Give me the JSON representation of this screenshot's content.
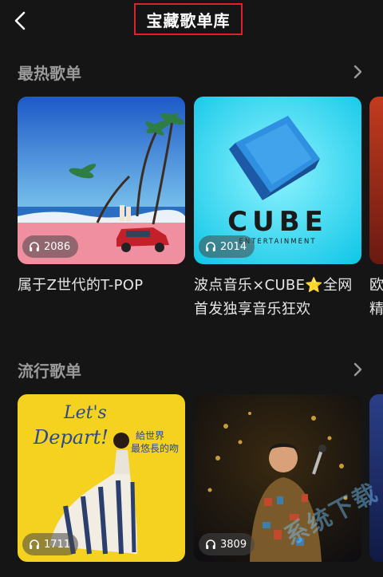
{
  "header": {
    "title": "宝藏歌单库"
  },
  "sections": [
    {
      "title": "最热歌单",
      "cards": [
        {
          "plays": "2086",
          "title": "属于Z世代的T-POP"
        },
        {
          "plays": "2014",
          "title": "波点音乐×CUBE⭐全网首发独享音乐狂欢"
        },
        {
          "peek_title": "欧精"
        }
      ]
    },
    {
      "title": "流行歌单",
      "cards": [
        {
          "plays": "1711",
          "cover_text_1": "Let's",
          "cover_text_2": "Depart!",
          "cover_text_3": "給世界",
          "cover_text_4": "最悠長的吻"
        },
        {
          "plays": "3809"
        }
      ]
    }
  ],
  "cube_logo": {
    "main": "CUBE",
    "sub": "ENTERTAINMENT"
  },
  "watermark": "系统下载",
  "icons": {
    "back": "chevron-left-icon",
    "more": "chevron-right-icon",
    "plays": "headphones-icon"
  }
}
